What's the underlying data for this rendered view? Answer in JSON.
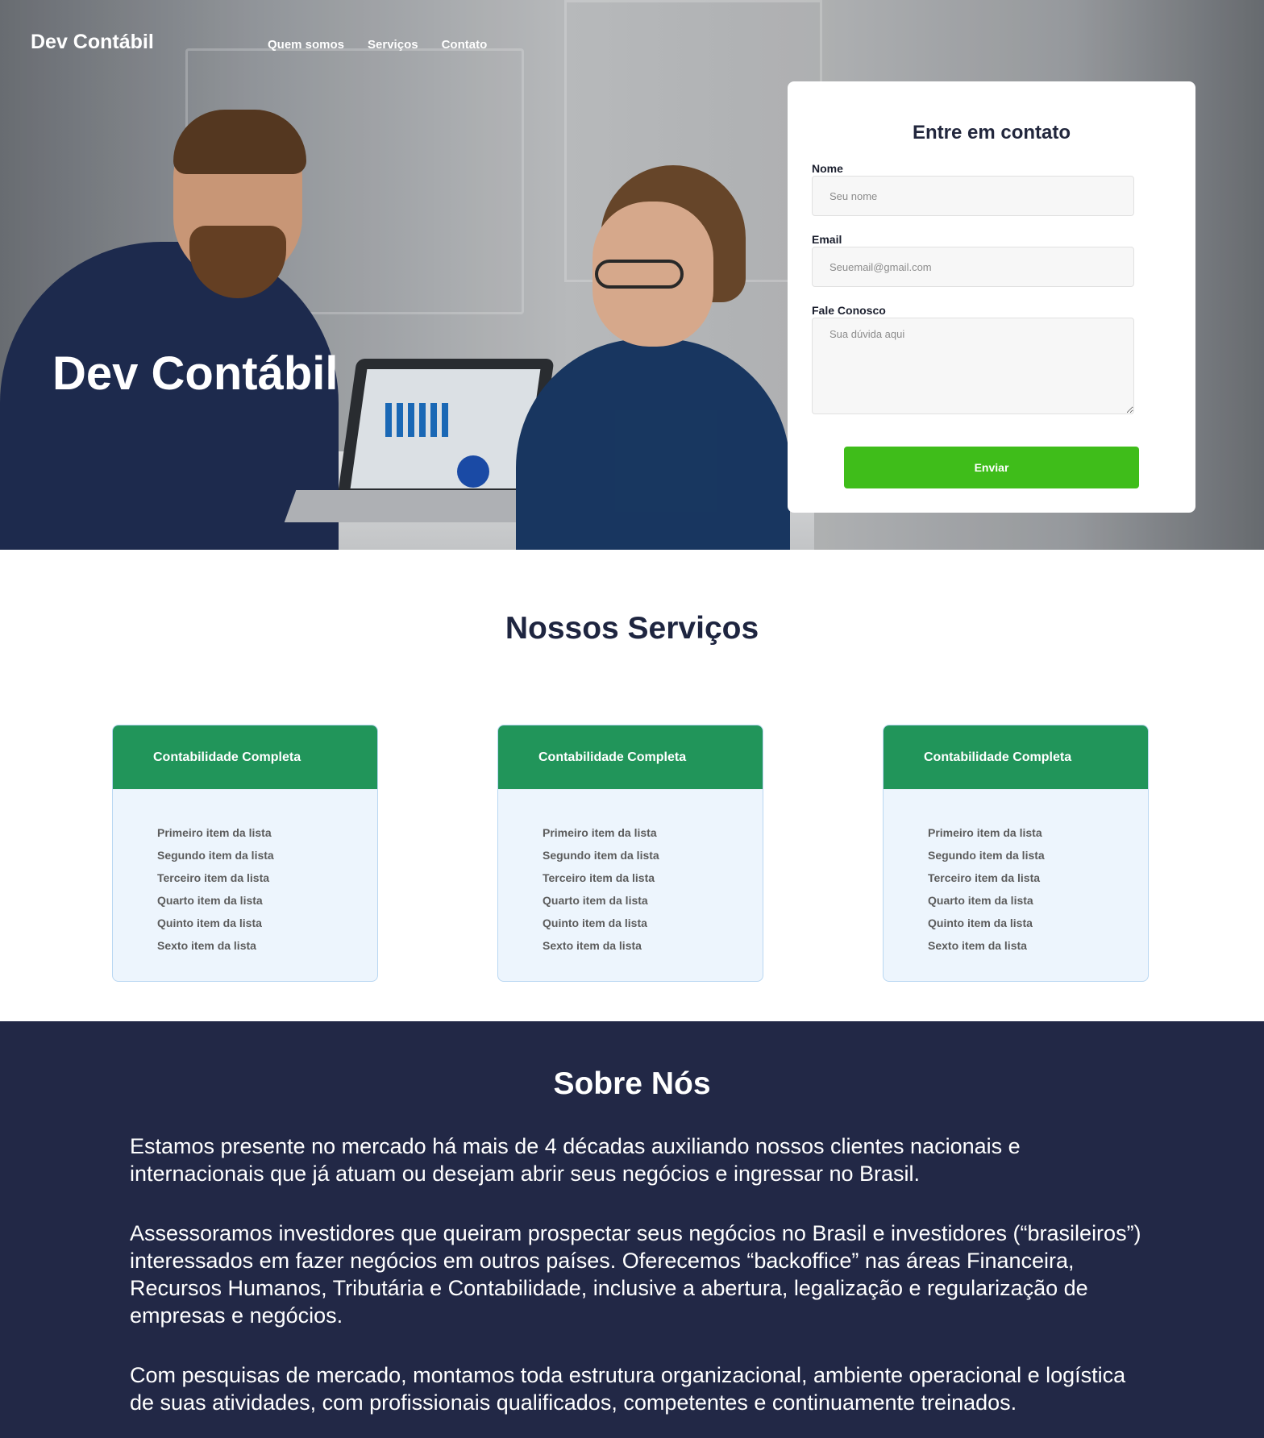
{
  "header": {
    "logo": "Dev Contábil",
    "nav": [
      "Quem somos",
      "Serviços",
      "Contato"
    ]
  },
  "hero": {
    "title": "Dev Contábil"
  },
  "contact_form": {
    "title": "Entre em contato",
    "name_label": "Nome",
    "name_placeholder": "Seu nome",
    "email_label": "Email",
    "email_placeholder": "Seuemail@gmail.com",
    "message_label": "Fale Conosco",
    "message_placeholder": "Sua dúvida aqui",
    "submit_label": "Enviar"
  },
  "services": {
    "title": "Nossos Serviços",
    "cards": [
      {
        "title": "Contabilidade Completa",
        "items": [
          "Primeiro item da lista",
          "Segundo item da lista",
          "Terceiro item da lista",
          "Quarto item da lista",
          "Quinto item da lista",
          "Sexto item da lista"
        ]
      },
      {
        "title": "Contabilidade Completa",
        "items": [
          "Primeiro item da lista",
          "Segundo item da lista",
          "Terceiro item da lista",
          "Quarto item da lista",
          "Quinto item da lista",
          "Sexto item da lista"
        ]
      },
      {
        "title": "Contabilidade Completa",
        "items": [
          "Primeiro item da lista",
          "Segundo item da lista",
          "Terceiro item da lista",
          "Quarto item da lista",
          "Quinto item da lista",
          "Sexto item da lista"
        ]
      }
    ]
  },
  "about": {
    "title": "Sobre Nós",
    "paragraphs": [
      "Estamos presente no mercado há mais de 4 décadas auxiliando nossos clientes nacionais e internacionais que já atuam ou desejam abrir seus negócios e ingressar no Brasil.",
      "Assessoramos investidores que queiram prospectar seus negócios no Brasil e investidores (“brasileiros”) interessados em fazer negócios em outros países. Oferecemos “backoffice” nas áreas Financeira, Recursos Humanos, Tributária e Contabilidade, inclusive a abertura, legalização e regularização de empresas e negócios.",
      "Com pesquisas de mercado, montamos toda estrutura organizacional, ambiente operacional e logística de suas atividades, com profissionais qualificados, competentes e continuamente treinados."
    ]
  },
  "colors": {
    "primary_dark": "#222846",
    "accent_green": "#3fbd1a",
    "card_header_green": "#21955a",
    "card_bg": "#edf5fd"
  }
}
